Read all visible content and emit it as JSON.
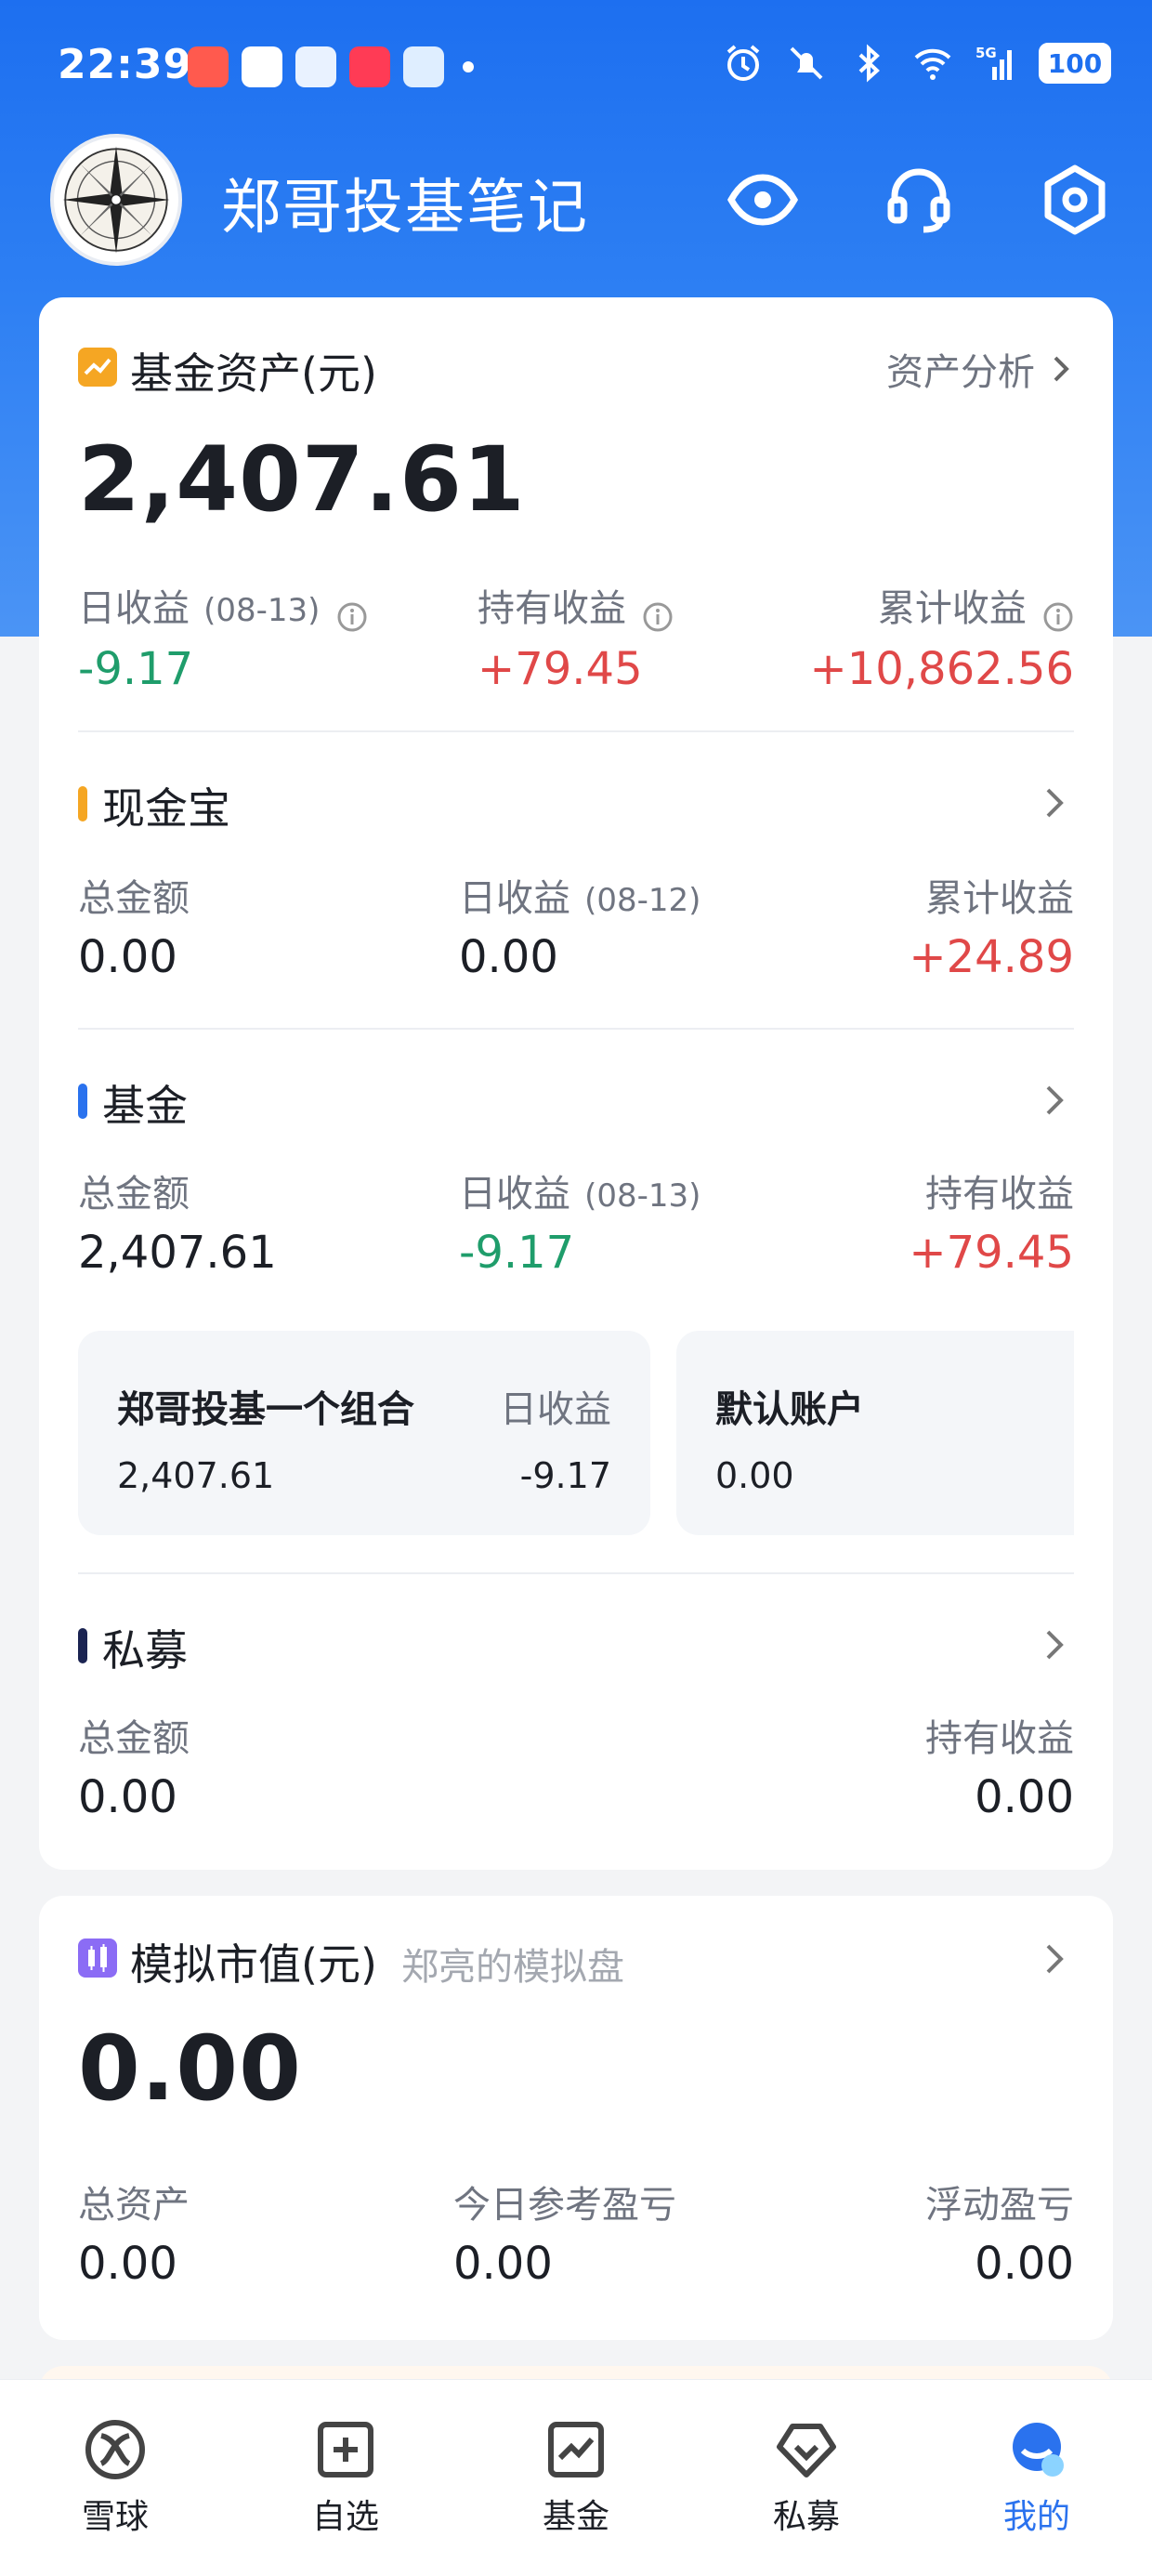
{
  "status_bar": {
    "time": "22:39",
    "battery": "100",
    "network": "5G"
  },
  "header": {
    "title": "郑哥投基笔记"
  },
  "assets": {
    "title": "基金资产(元)",
    "analysis_link": "资产分析",
    "total": "2,407.61",
    "daily_label": "日收益",
    "daily_date": "(08-13)",
    "daily_value": "-9.17",
    "holding_label": "持有收益",
    "holding_value": "+79.45",
    "cumulative_label": "累计收益",
    "cumulative_value": "+10,862.56"
  },
  "cash": {
    "title": "现金宝",
    "total_label": "总金额",
    "total_value": "0.00",
    "daily_label": "日收益",
    "daily_date": "(08-12)",
    "daily_value": "0.00",
    "cumulative_label": "累计收益",
    "cumulative_value": "+24.89"
  },
  "fund": {
    "title": "基金",
    "total_label": "总金额",
    "total_value": "2,407.61",
    "daily_label": "日收益",
    "daily_date": "(08-13)",
    "daily_value": "-9.17",
    "holding_label": "持有收益",
    "holding_value": "+79.45",
    "portfolios": [
      {
        "name": "郑哥投基一个组合",
        "daily_label": "日收益",
        "amount": "2,407.61",
        "daily_value": "-9.17"
      },
      {
        "name": "默认账户",
        "amount": "0.00"
      }
    ]
  },
  "private": {
    "title": "私募",
    "total_label": "总金额",
    "total_value": "0.00",
    "holding_label": "持有收益",
    "holding_value": "0.00"
  },
  "simulation": {
    "title": "模拟市值(元)",
    "subtitle": "郑亮的模拟盘",
    "total": "0.00",
    "asset_label": "总资产",
    "asset_value": "0.00",
    "today_label": "今日参考盈亏",
    "today_value": "0.00",
    "float_label": "浮动盈亏",
    "float_value": "0.00"
  },
  "nav": [
    {
      "label": "雪球",
      "icon": "snowball-icon"
    },
    {
      "label": "自选",
      "icon": "add-square-icon"
    },
    {
      "label": "基金",
      "icon": "chart-square-icon"
    },
    {
      "label": "私募",
      "icon": "diamond-heart-icon"
    },
    {
      "label": "我的",
      "icon": "profile-bubble-icon",
      "active": true
    }
  ],
  "colors": {
    "primary": "#1d6ff0",
    "gain": "#e04848",
    "loss": "#1f9d6b",
    "active_tab": "#2a72ee"
  }
}
